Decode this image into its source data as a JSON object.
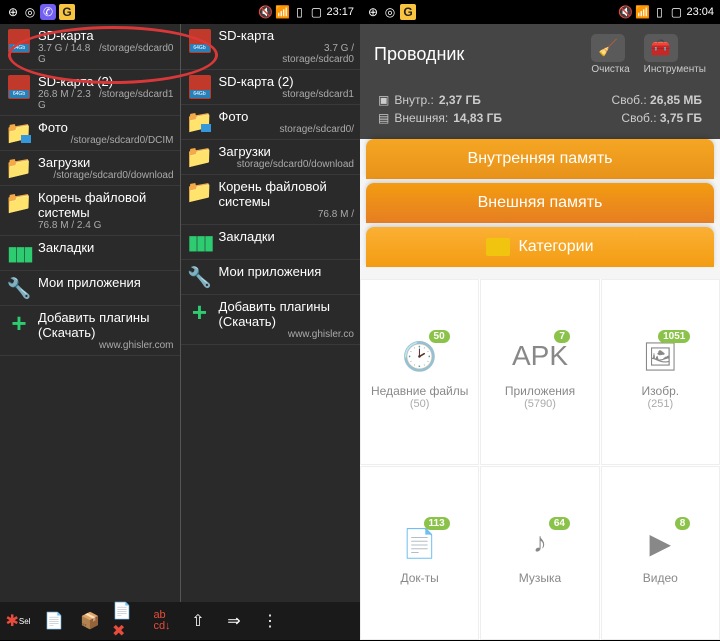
{
  "p1": {
    "statusbar": {
      "time": "23:17"
    },
    "entries_left": [
      {
        "title": "SD-карта",
        "size": "3.7 G / 14.8 G",
        "path": "/storage/sdcard0",
        "icon": "sd"
      },
      {
        "title": "SD-карта (2)",
        "size": "26.8 M / 2.3 G",
        "path": "/storage/sdcard1",
        "icon": "sd"
      },
      {
        "title": "Фото",
        "size": "",
        "path": "/storage/sdcard0/DCIM",
        "icon": "folder-img"
      },
      {
        "title": "Загрузки",
        "size": "",
        "path": "/storage/sdcard0/download",
        "icon": "folder"
      },
      {
        "title": "Корень файловой системы",
        "size": "76.8 M / 2.4 G",
        "path": "",
        "icon": "folder"
      },
      {
        "title": "Закладки",
        "size": "",
        "path": "",
        "icon": "bookmarks"
      },
      {
        "title": "Мои приложения",
        "size": "",
        "path": "",
        "icon": "apps"
      },
      {
        "title": "Добавить плагины (Скачать)",
        "size": "",
        "path": "www.ghisler.com",
        "icon": "plus"
      }
    ],
    "entries_right": [
      {
        "title": "SD-карта",
        "size": "3.7 G /",
        "path": "storage/sdcard0",
        "icon": "sd"
      },
      {
        "title": "SD-карта (2)",
        "size": "",
        "path": "storage/sdcard1",
        "icon": "sd"
      },
      {
        "title": "Фото",
        "size": "",
        "path": "storage/sdcard0/",
        "icon": "folder-img"
      },
      {
        "title": "Загрузки",
        "size": "",
        "path": "storage/sdcard0/download",
        "icon": "folder"
      },
      {
        "title": "Корень файловой системы",
        "size": "76.8 M /",
        "path": "",
        "icon": "folder"
      },
      {
        "title": "Закладки",
        "size": "",
        "path": "",
        "icon": "bookmarks"
      },
      {
        "title": "Мои приложения",
        "size": "",
        "path": "",
        "icon": "apps"
      },
      {
        "title": "Добавить плагины (Скачать)",
        "size": "",
        "path": "www.ghisler.co",
        "icon": "plus"
      }
    ]
  },
  "p2": {
    "statusbar": {
      "time": "23:04"
    },
    "title": "Проводник",
    "actions": {
      "clean": "Очистка",
      "tools": "Инструменты"
    },
    "storage": {
      "internal_label": "Внутр.:",
      "internal_total": "2,37 ГБ",
      "internal_free_label": "Своб.:",
      "internal_free": "26,85 МБ",
      "external_label": "Внешняя:",
      "external_total": "14,83 ГБ",
      "external_free_label": "Своб.:",
      "external_free": "3,75 ГБ"
    },
    "cards": {
      "c1": "Внутренняя память",
      "c2": "Внешняя память",
      "c3": "Категории"
    },
    "cats": [
      {
        "name": "Недавние файлы",
        "count": "(50)",
        "badge": "50",
        "icon": "🕑"
      },
      {
        "name": "Приложения",
        "count": "(5790)",
        "badge": "7",
        "icon": "APK"
      },
      {
        "name": "Изобр.",
        "count": "(251)",
        "badge": "1051",
        "icon": "🖼"
      },
      {
        "name": "Док-ты",
        "count": "",
        "badge": "113",
        "icon": "📄"
      },
      {
        "name": "Музыка",
        "count": "",
        "badge": "64",
        "icon": "♪"
      },
      {
        "name": "Видео",
        "count": "",
        "badge": "8",
        "icon": "▶"
      }
    ]
  }
}
